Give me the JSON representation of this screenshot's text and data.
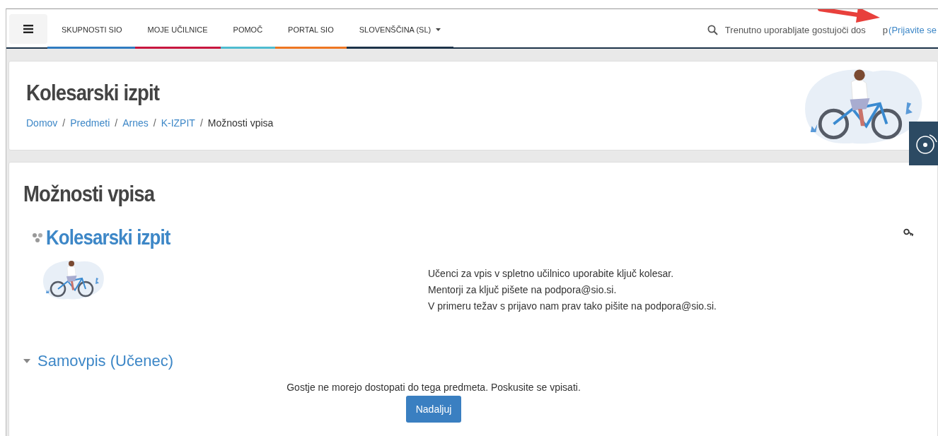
{
  "navbar": {
    "items": [
      {
        "label": "SKUPNOSTI SIO",
        "color": "#2f7bc0",
        "dropdown": false
      },
      {
        "label": "MOJE UČILNICE",
        "color": "#c8163f",
        "dropdown": false
      },
      {
        "label": "POMOČ",
        "color": "#4fbcd0",
        "dropdown": false
      },
      {
        "label": "PORTAL SIO",
        "color": "#ee7622",
        "dropdown": false
      },
      {
        "label": "SLOVENŠČINA (SL)",
        "color": "#1d3349",
        "dropdown": true
      }
    ],
    "guest_text": "Trenutno uporabljate gostujoči dos",
    "guest_text_end": "p",
    "login_link": "(Prijavite se"
  },
  "header": {
    "title": "Kolesarski izpit",
    "breadcrumb_separator": "/",
    "breadcrumb": [
      {
        "label": "Domov",
        "link": true
      },
      {
        "label": "Predmeti",
        "link": true
      },
      {
        "label": "Arnes",
        "link": true
      },
      {
        "label": "K-IZPIT",
        "link": true
      },
      {
        "label": "Možnosti vpisa",
        "link": false
      }
    ]
  },
  "page": {
    "title": "Možnosti vpisa",
    "course": {
      "name": "Kolesarski izpit",
      "summary": [
        "Učenci za vpis v spletno učilnico uporabite ključ kolesar.",
        "Mentorji za ključ pišete na podpora@sio.si.",
        "V primeru težav s prijavo nam prav tako pišite na podpora@sio.si."
      ]
    },
    "section": {
      "title": "Samovpis (Učenec)",
      "expanded": true,
      "message": "Gostje ne morejo dostopati do tega predmeta. Poskusite se vpisati.",
      "button": "Nadaljuj"
    }
  }
}
